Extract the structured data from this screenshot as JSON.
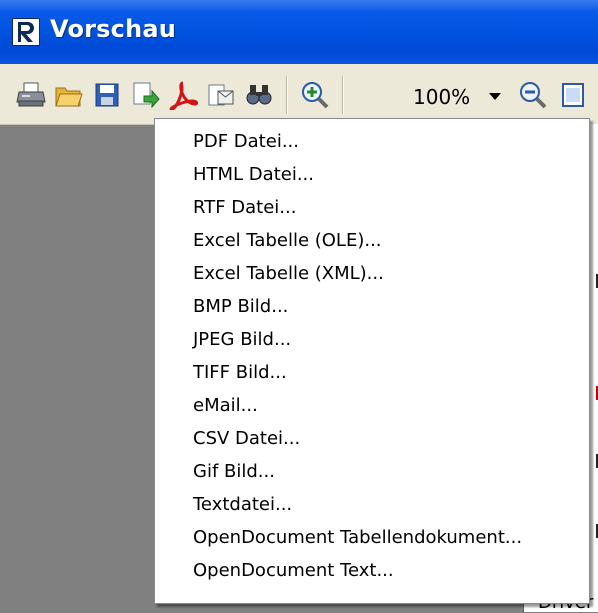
{
  "window": {
    "title": "Vorschau"
  },
  "toolbar": {
    "icons": [
      "print-icon",
      "open-folder-icon",
      "save-icon",
      "export-icon",
      "pdf-icon",
      "email-icon",
      "find-icon",
      "zoom-in-icon",
      "zoom-out-icon",
      "page-icon"
    ],
    "zoom_value": "100%"
  },
  "export_menu": {
    "items": [
      "PDF Datei...",
      "HTML Datei...",
      "RTF Datei...",
      "Excel Tabelle (OLE)...",
      "Excel Tabelle (XML)...",
      "BMP Bild...",
      "JPEG Bild...",
      "TIFF Bild...",
      "eMail...",
      "CSV Datei...",
      "Gif Bild...",
      "Textdatei...",
      "OpenDocument Tabellendokument...",
      "OpenDocument Text..."
    ]
  },
  "preview_page": {
    "visible_text": "Driver"
  },
  "colors": {
    "titlebar": "#0053e0",
    "toolbar": "#ece9d8",
    "workspace": "#808080",
    "menu": "#ffffff"
  }
}
